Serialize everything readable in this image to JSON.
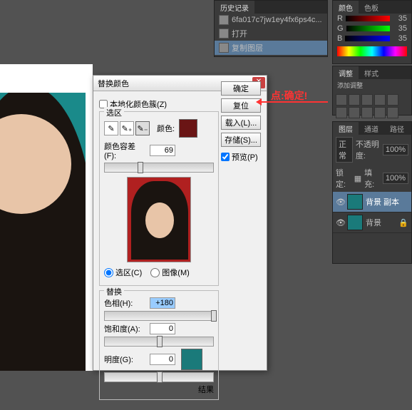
{
  "dialog": {
    "title": "替换颜色",
    "localize_checkbox": "本地化颜色簇(Z)",
    "section_selection": "选区",
    "color_label": "颜色:",
    "fuzziness_label": "颜色容差(F):",
    "fuzziness_value": "69",
    "radio_selection": "选区(C)",
    "radio_image": "图像(M)",
    "section_replace": "替换",
    "hue_label": "色相(H):",
    "hue_value": "+180",
    "saturation_label": "饱和度(A):",
    "saturation_value": "0",
    "lightness_label": "明度(G):",
    "lightness_value": "0",
    "result_label": "结果",
    "btn_ok": "确定",
    "btn_reset": "复位",
    "btn_load": "载入(L)...",
    "btn_save": "存储(S)...",
    "preview_checkbox": "预览(P)",
    "swatch_color": "#6a1515",
    "result_color": "#1a7a7a"
  },
  "annotation": {
    "text": "点:确定!"
  },
  "history": {
    "tab": "历史记录",
    "filename": "6fa017c7jw1ey4fx6ps4c...",
    "items": [
      "打开",
      "复制图层"
    ]
  },
  "color": {
    "tab1": "颜色",
    "tab2": "色板",
    "r_label": "R",
    "r_val": "35",
    "g_label": "G",
    "g_val": "35",
    "b_label": "B",
    "b_val": "35"
  },
  "adjustments": {
    "tab1": "调整",
    "tab2": "样式",
    "label": "添加调整"
  },
  "layers": {
    "tab1": "图层",
    "tab2": "通道",
    "tab3": "路径",
    "blend": "正常",
    "opacity_label": "不透明度:",
    "opacity": "100%",
    "lock_label": "锁定:",
    "fill_label": "填充:",
    "fill": "100%",
    "layer1": "背景 副本",
    "layer2": "背景"
  }
}
